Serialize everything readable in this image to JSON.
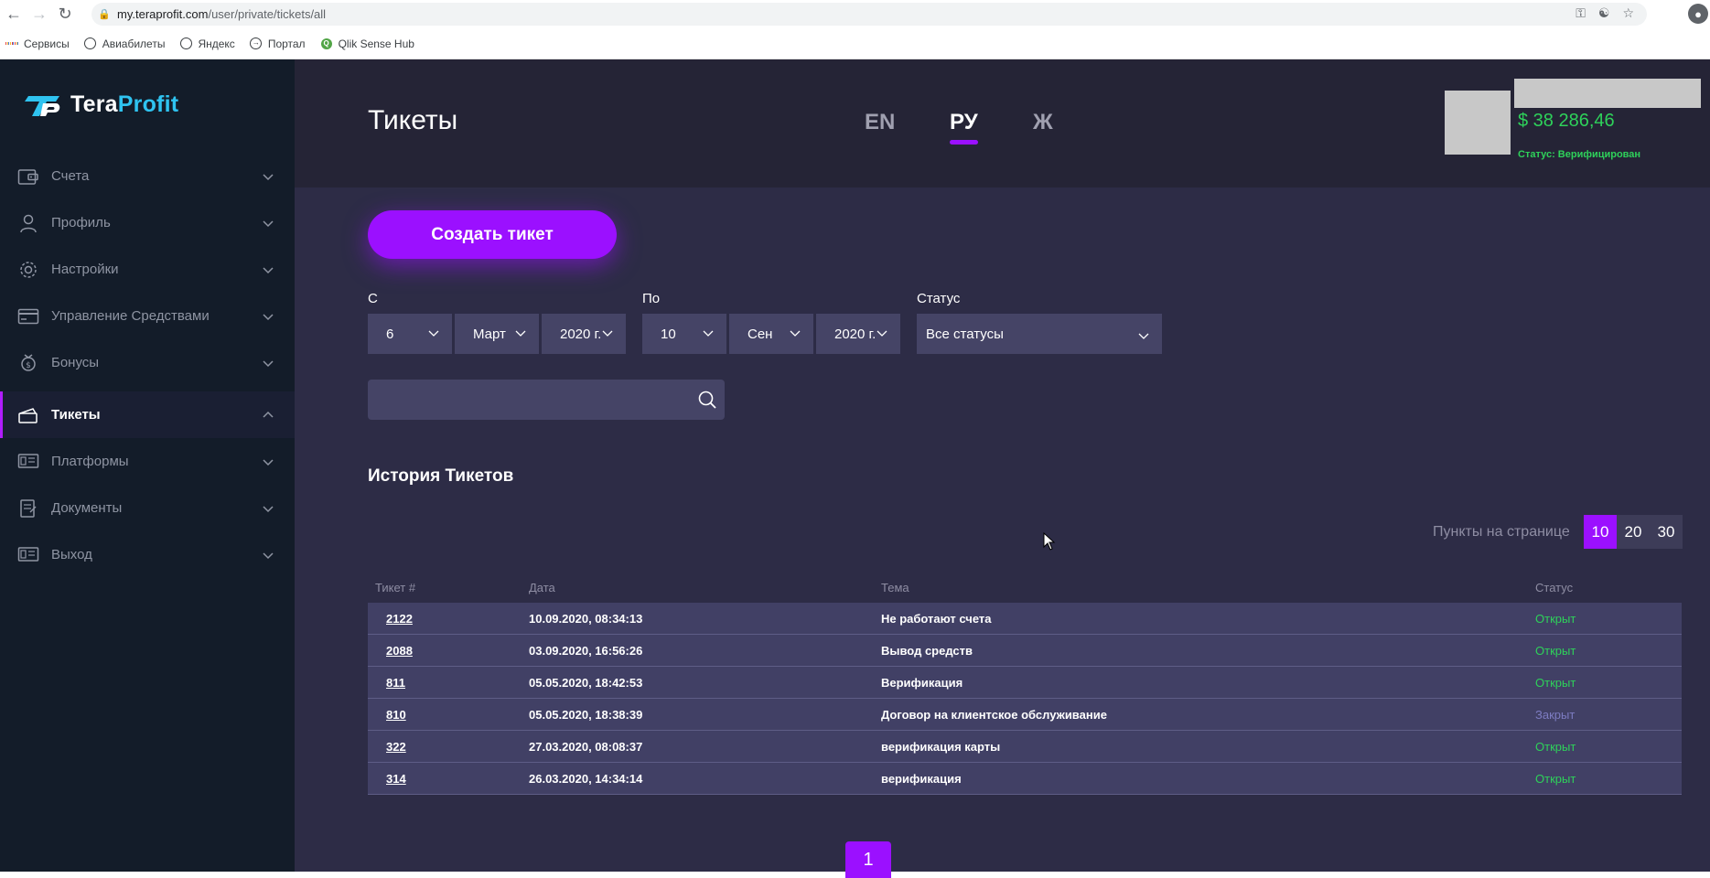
{
  "browser": {
    "url_host": "my.teraprofit.com",
    "url_path": "/user/private/tickets/all",
    "bookmarks": [
      "Сервисы",
      "Авиабилеты",
      "Яндекс",
      "Портал",
      "Qlik Sense Hub"
    ]
  },
  "sidebar": {
    "logo_prefix": "Tera",
    "logo_suffix": "Profit",
    "items": [
      {
        "label": "Счета",
        "icon": "wallet-icon"
      },
      {
        "label": "Профиль",
        "icon": "user-icon"
      },
      {
        "label": "Настройки",
        "icon": "gear-icon"
      },
      {
        "label": "Управление Средствами",
        "icon": "card-icon"
      },
      {
        "label": "Бонусы",
        "icon": "bonus-icon"
      },
      {
        "label": "Тикеты",
        "icon": "ticket-icon"
      },
      {
        "label": "Платформы",
        "icon": "platform-icon"
      },
      {
        "label": "Документы",
        "icon": "document-icon"
      },
      {
        "label": "Выход",
        "icon": "exit-icon"
      }
    ]
  },
  "header": {
    "title": "Тикеты",
    "languages": [
      "EN",
      "РУ",
      "Ж"
    ],
    "active_language": "РУ",
    "balance": "$ 38 286,46",
    "status": "Статус: Верифицирован"
  },
  "actions": {
    "create_ticket": "Создать тикет"
  },
  "filters": {
    "from_label": "С",
    "to_label": "По",
    "status_label": "Статус",
    "from_day": "6",
    "from_month": "Март",
    "from_year": "2020 г.",
    "to_day": "10",
    "to_month": "Сен",
    "to_year": "2020 г.",
    "status_value": "Все статусы"
  },
  "search": {
    "placeholder": ""
  },
  "history": {
    "title": "История Тикетов",
    "per_page_label": "Пункты на странице",
    "per_page_options": [
      "10",
      "20",
      "30"
    ],
    "per_page_selected": "10",
    "columns": [
      "Тикет #",
      "Дата",
      "Тема",
      "Статус"
    ],
    "rows": [
      {
        "id": "2122",
        "date": "10.09.2020, 08:34:13",
        "subject": "Не работают счета",
        "status": "Открыт"
      },
      {
        "id": "2088",
        "date": "03.09.2020, 16:56:26",
        "subject": "Вывод средств",
        "status": "Открыт"
      },
      {
        "id": "811",
        "date": "05.05.2020, 18:42:53",
        "subject": "Верификация",
        "status": "Открыт"
      },
      {
        "id": "810",
        "date": "05.05.2020, 18:38:39",
        "subject": "Договор на клиентское обслуживание",
        "status": "Закрыт"
      },
      {
        "id": "322",
        "date": "27.03.2020, 08:08:37",
        "subject": "верификация карты",
        "status": "Открыт"
      },
      {
        "id": "314",
        "date": "26.03.2020, 14:34:14",
        "subject": "верификация",
        "status": "Открыт"
      }
    ],
    "page": "1"
  },
  "colors": {
    "accent": "#9b10ff",
    "open": "#2ed15a",
    "closed": "#7d7cc2",
    "sidebar_bg": "#131c29",
    "main_bg": "#2d2c46"
  }
}
